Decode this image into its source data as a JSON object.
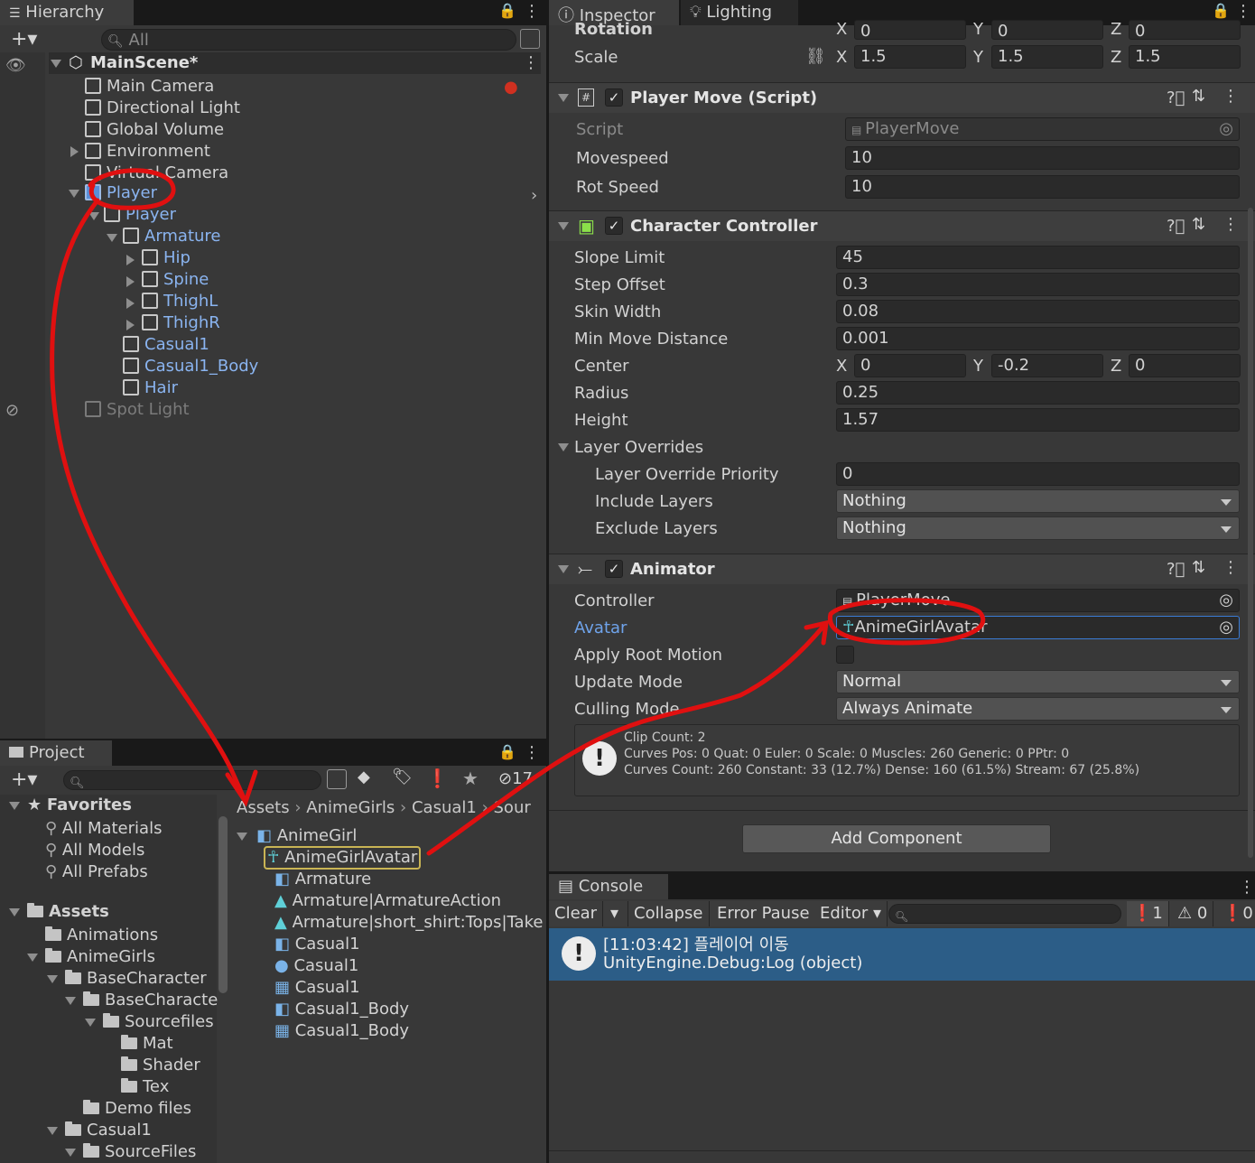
{
  "hierarchy": {
    "tab_label": "Hierarchy",
    "search_placeholder": "All",
    "scene_name": "MainScene*",
    "items": [
      "Main Camera",
      "Directional Light",
      "Global Volume",
      "Environment",
      "Virtual Camera",
      "Player",
      "Player",
      "Armature",
      "Hip",
      "Spine",
      "ThighL",
      "ThighR",
      "Casual1",
      "Casual1_Body",
      "Hair",
      "Spot Light"
    ]
  },
  "project": {
    "tab_label": "Project",
    "hidden_count": "17",
    "favorites_label": "Favorites",
    "favorites": [
      "All Materials",
      "All Models",
      "All Prefabs"
    ],
    "assets_label": "Assets",
    "folders": [
      "Animations",
      "AnimeGirls",
      "BaseCharacter",
      "BaseCharacte",
      "Sourcefiles",
      "Mat",
      "Shader",
      "Tex",
      "Demo files",
      "Casual1",
      "SourceFiles"
    ],
    "breadcrumb": [
      "Assets",
      "AnimeGirls",
      "Casual1",
      "Sour"
    ],
    "files": [
      "AnimeGirl",
      "AnimeGirlAvatar",
      "Armature",
      "Armature|ArmatureAction",
      "Armature|short_shirt:Tops|Take",
      "Casual1",
      "Casual1",
      "Casual1",
      "Casual1_Body",
      "Casual1_Body"
    ]
  },
  "inspector": {
    "tabs": [
      "Inspector",
      "Lighting"
    ],
    "transform": {
      "rotation_label": "Rotation",
      "rotation": {
        "x": "0",
        "y": "0",
        "z": "0"
      },
      "scale_label": "Scale",
      "scale": {
        "x": "1.5",
        "y": "1.5",
        "z": "1.5"
      },
      "axis": {
        "x": "X",
        "y": "Y",
        "z": "Z"
      }
    },
    "player_move": {
      "title": "Player Move (Script)",
      "script_label": "Script",
      "script_value": "PlayerMove",
      "movespeed_label": "Movespeed",
      "movespeed": "10",
      "rotspeed_label": "Rot Speed",
      "rotspeed": "10"
    },
    "character_controller": {
      "title": "Character Controller",
      "slope_limit_label": "Slope Limit",
      "slope_limit": "45",
      "step_offset_label": "Step Offset",
      "step_offset": "0.3",
      "skin_width_label": "Skin Width",
      "skin_width": "0.08",
      "min_move_label": "Min Move Distance",
      "min_move": "0.001",
      "center_label": "Center",
      "center": {
        "x": "0",
        "y": "-0.2",
        "z": "0"
      },
      "radius_label": "Radius",
      "radius": "0.25",
      "height_label": "Height",
      "height": "1.57",
      "layer_overrides_label": "Layer Overrides",
      "priority_label": "Layer Override Priority",
      "priority": "0",
      "include_label": "Include Layers",
      "include": "Nothing",
      "exclude_label": "Exclude Layers",
      "exclude": "Nothing"
    },
    "animator": {
      "title": "Animator",
      "controller_label": "Controller",
      "controller": "PlayerMove",
      "avatar_label": "Avatar",
      "avatar": "AnimeGirlAvatar",
      "apply_root_label": "Apply Root Motion",
      "update_mode_label": "Update Mode",
      "update_mode": "Normal",
      "culling_label": "Culling Mode",
      "culling": "Always Animate",
      "info_line1": "Clip Count: 2",
      "info_line2": "Curves Pos: 0 Quat: 0 Euler: 0 Scale: 0 Muscles: 260 Generic: 0 PPtr: 0",
      "info_line3": "Curves Count: 260 Constant: 33 (12.7%) Dense: 160 (61.5%) Stream: 67 (25.8%)"
    },
    "add_component": "Add Component"
  },
  "console": {
    "tab_label": "Console",
    "clear": "Clear",
    "collapse": "Collapse",
    "error_pause": "Error Pause",
    "editor": "Editor",
    "info_count": "1",
    "warn_count": "0",
    "error_count": "0",
    "log_line1": "[11:03:42] 플레이어 이동",
    "log_line2": "UnityEngine.Debug:Log (object)"
  },
  "colors": {
    "annotation": "#e01010",
    "selection": "#2c5d87",
    "accent_blue": "#8ab4f0"
  }
}
